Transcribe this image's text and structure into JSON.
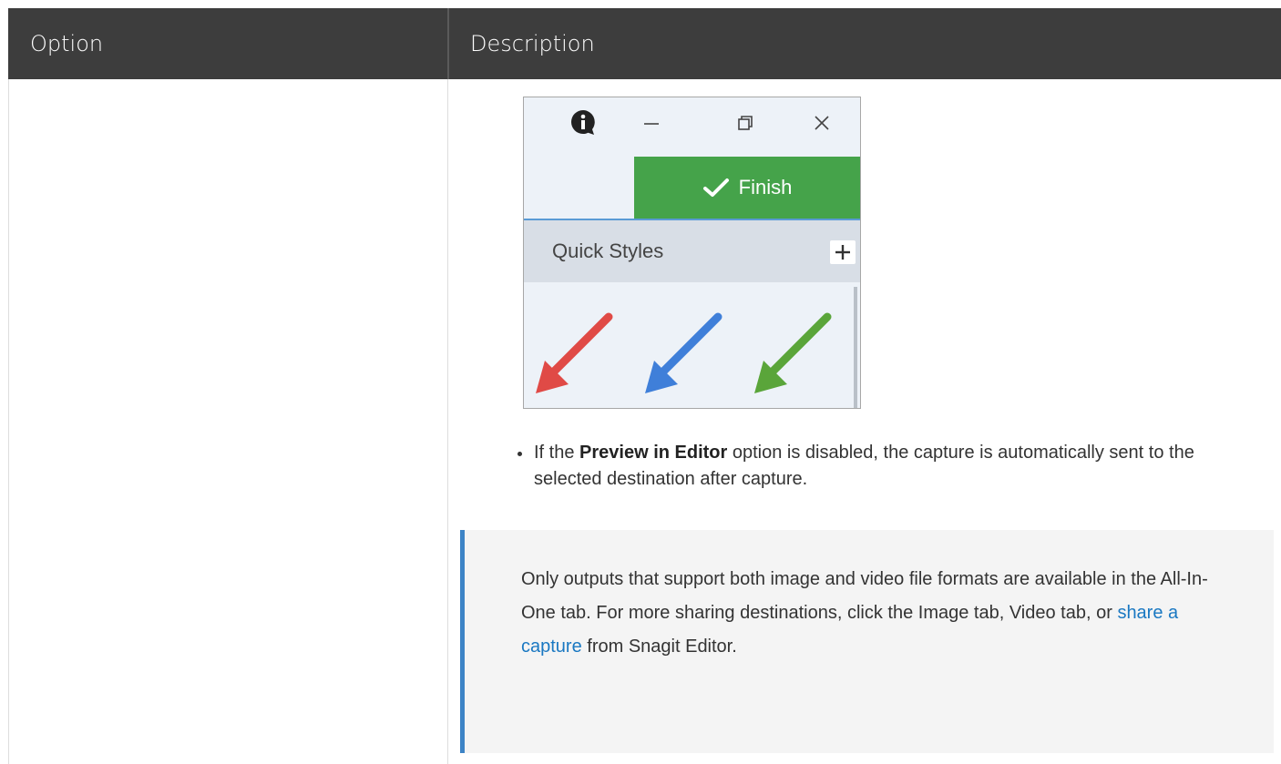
{
  "header": {
    "option_label": "Option",
    "description_label": "Description"
  },
  "screenshot": {
    "finish_label": "Finish",
    "quick_styles_label": "Quick Styles",
    "arrow_colors": [
      "#e04a46",
      "#3f7fd9",
      "#5aa53a"
    ],
    "finish_color": "#45a34a",
    "icons": [
      "info-icon",
      "minimize-icon",
      "restore-icon",
      "close-icon",
      "checkmark-icon",
      "plus-icon"
    ]
  },
  "bullet": {
    "prefix": "If the ",
    "bold": "Preview in Editor",
    "suffix": " option is disabled, the capture is automatically sent to the selected destination after capture."
  },
  "note": {
    "text_before": "Only outputs that support both image and video file formats are available in the All-In-One tab. For more sharing destinations, click the Image tab, Video tab, or ",
    "link_text": "share a capture",
    "text_after": " from Snagit Editor."
  },
  "colors": {
    "header_bg": "#3d3d3d",
    "note_bg": "#f4f4f4",
    "note_accent": "#3d84c6",
    "link": "#1a78c2"
  }
}
